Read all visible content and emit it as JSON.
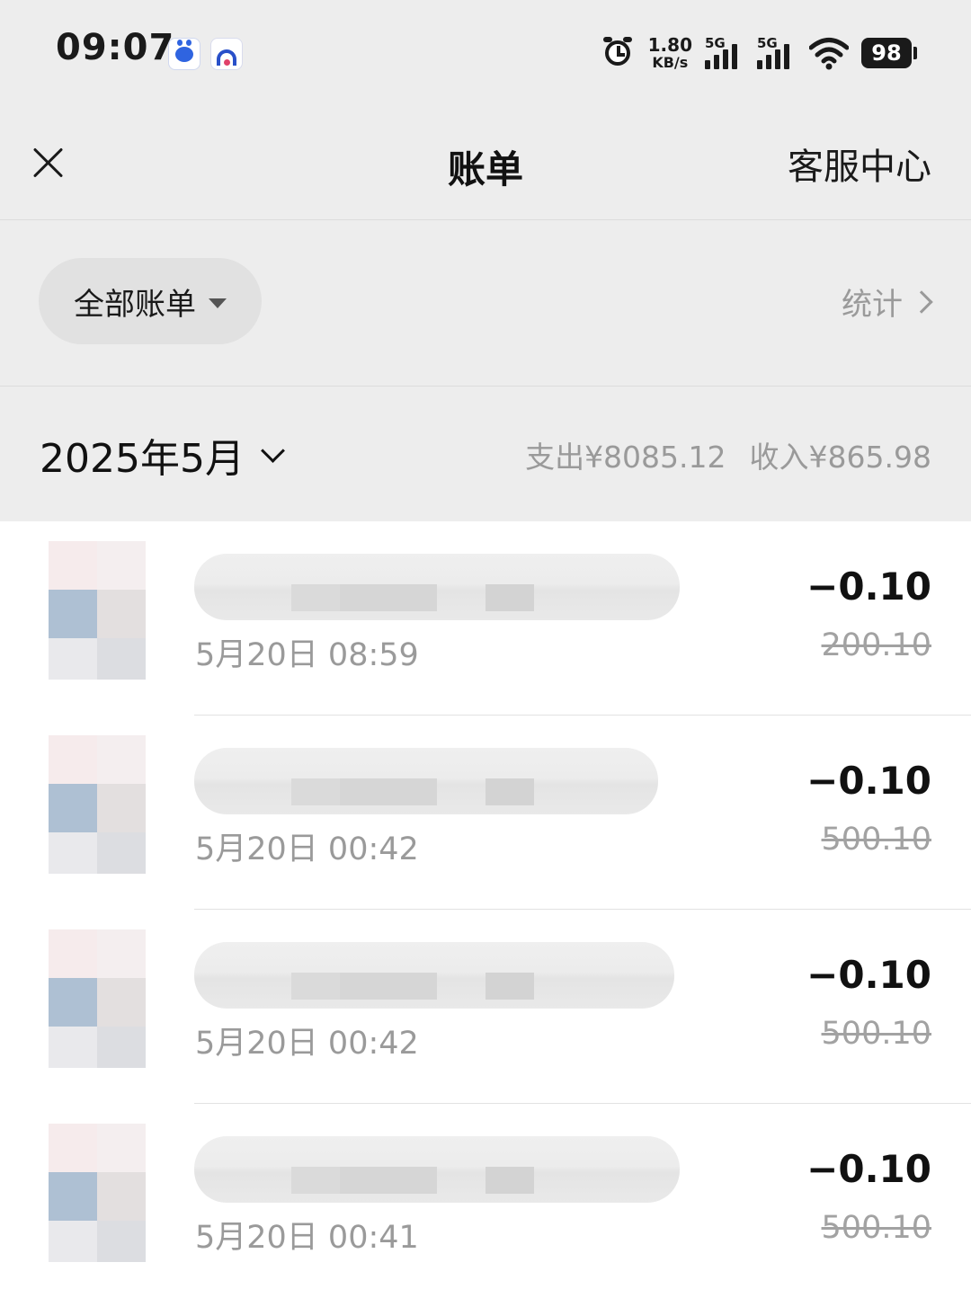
{
  "status_bar": {
    "time": "09:07",
    "net_speed_value": "1.80",
    "net_speed_unit": "KB/s",
    "signal_1_label": "5G",
    "signal_2_label": "5G",
    "battery": "98",
    "icons": [
      "baidu-app-icon",
      "car-app-icon",
      "alarm-icon",
      "signal-icon",
      "wifi-icon",
      "battery-icon"
    ]
  },
  "nav": {
    "title": "账单",
    "right_link": "客服中心",
    "close_icon": "close-icon"
  },
  "filter": {
    "label": "全部账单",
    "stats_link": "统计"
  },
  "month": {
    "label": "2025年5月",
    "expense": "支出¥8085.12",
    "income": "收入¥865.98"
  },
  "bills": [
    {
      "time": "5月20日 08:59",
      "amount": "−0.10",
      "original": "200.10"
    },
    {
      "time": "5月20日 00:42",
      "amount": "−0.10",
      "original": "500.10"
    },
    {
      "time": "5月20日 00:42",
      "amount": "−0.10",
      "original": "500.10"
    },
    {
      "time": "5月20日 00:41",
      "amount": "−0.10",
      "original": "500.10"
    }
  ],
  "colors": {
    "header_bg": "#ededed",
    "muted_text": "#9a9a9a",
    "primary_text": "#111111"
  }
}
